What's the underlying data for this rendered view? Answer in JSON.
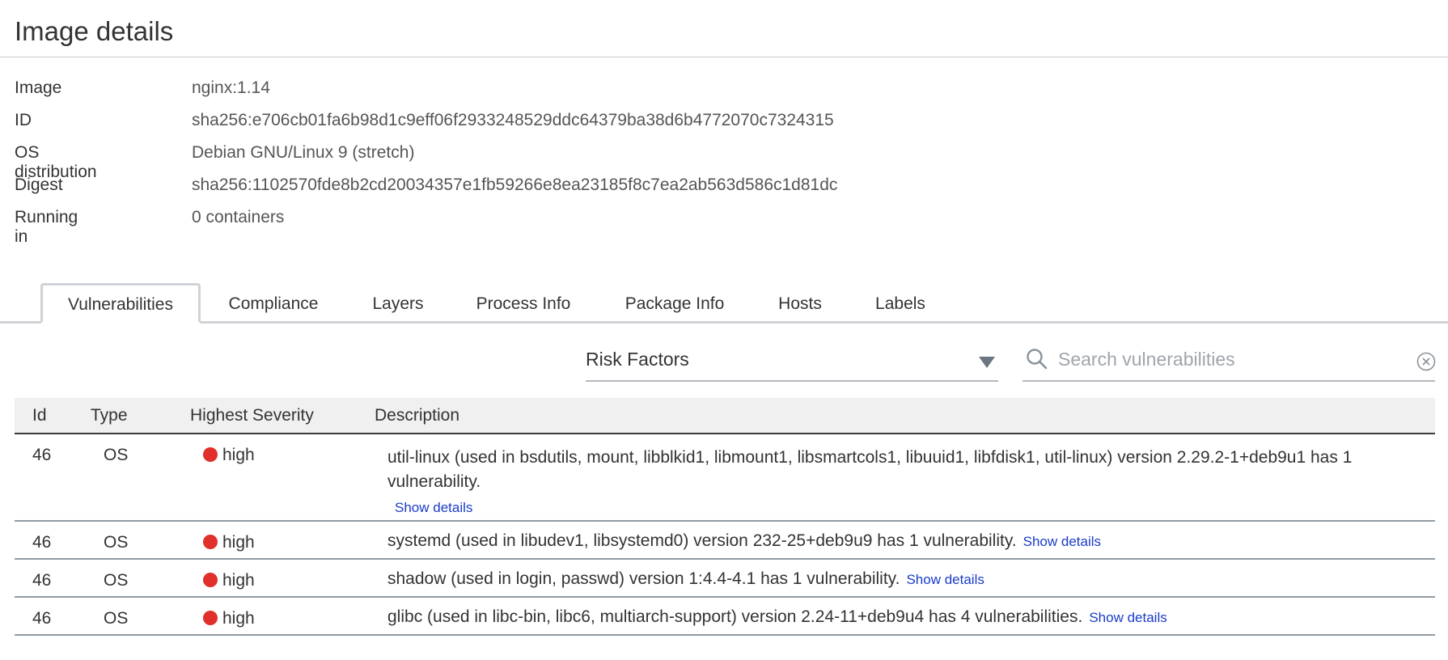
{
  "page": {
    "title": "Image details"
  },
  "meta": [
    {
      "label": "Image",
      "value": "nginx:1.14"
    },
    {
      "label": "ID",
      "value": "sha256:e706cb01fa6b98d1c9eff06f2933248529ddc64379ba38d6b4772070c7324315"
    },
    {
      "label": "OS distribution",
      "value": "Debian GNU/Linux 9 (stretch)"
    },
    {
      "label": "Digest",
      "value": "sha256:1102570fde8b2cd20034357e1fb59266e8ea23185f8c7ea2ab563d586c1d81dc"
    },
    {
      "label": "Running in",
      "value": "0 containers"
    }
  ],
  "tabs": [
    {
      "label": "Vulnerabilities",
      "active": true
    },
    {
      "label": "Compliance"
    },
    {
      "label": "Layers"
    },
    {
      "label": "Process Info"
    },
    {
      "label": "Package Info"
    },
    {
      "label": "Hosts"
    },
    {
      "label": "Labels"
    }
  ],
  "filters": {
    "risk_factors": "Risk Factors",
    "search_placeholder": "Search vulnerabilities",
    "icons": {
      "search": "search-icon",
      "clear": "clear-icon",
      "dropdown": "caret-down-icon"
    }
  },
  "table": {
    "columns": [
      "Id",
      "Type",
      "Highest Severity",
      "Description"
    ],
    "show_details_label": "Show details",
    "severity_color": "#e0302b",
    "link_color": "#1a3cc9",
    "rows": [
      {
        "id": "46",
        "type": "OS",
        "severity": "high",
        "description": "util-linux (used in bsdutils, mount, libblkid1, libmount1, libsmartcols1, libuuid1, libfdisk1, util-linux) version 2.29.2-1+deb9u1 has 1 vulnerability."
      },
      {
        "id": "46",
        "type": "OS",
        "severity": "high",
        "description": "systemd (used in libudev1, libsystemd0) version 232-25+deb9u9 has 1 vulnerability."
      },
      {
        "id": "46",
        "type": "OS",
        "severity": "high",
        "description": "shadow (used in login, passwd) version 1:4.4-4.1 has 1 vulnerability."
      },
      {
        "id": "46",
        "type": "OS",
        "severity": "high",
        "description": "glibc (used in libc-bin, libc6, multiarch-support) version 2.24-11+deb9u4 has 4 vulnerabilities."
      }
    ]
  }
}
